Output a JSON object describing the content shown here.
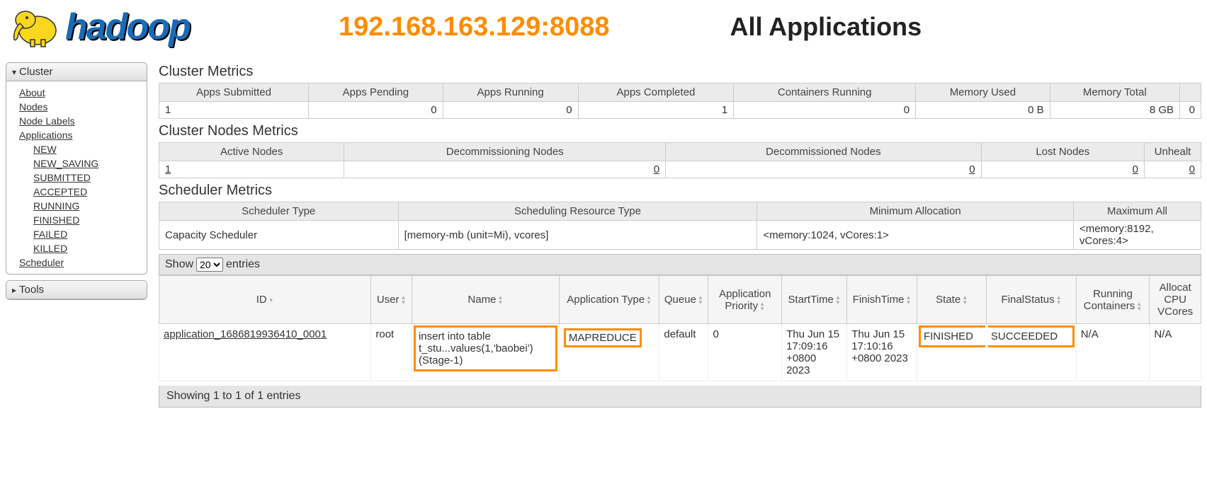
{
  "header": {
    "logo_text": "hadoop",
    "ip": "192.168.163.129:8088",
    "page_title": "All Applications"
  },
  "sidebar": {
    "cluster_label": "Cluster",
    "tools_label": "Tools",
    "links": {
      "about": "About",
      "nodes": "Nodes",
      "node_labels": "Node Labels",
      "applications": "Applications",
      "scheduler": "Scheduler"
    },
    "app_states": {
      "new": "NEW",
      "new_saving": "NEW_SAVING",
      "submitted": "SUBMITTED",
      "accepted": "ACCEPTED",
      "running": "RUNNING",
      "finished": "FINISHED",
      "failed": "FAILED",
      "killed": "KILLED"
    }
  },
  "sections": {
    "cluster_metrics": "Cluster Metrics",
    "cluster_nodes": "Cluster Nodes Metrics",
    "scheduler": "Scheduler Metrics"
  },
  "cluster_metrics": {
    "headers": {
      "apps_submitted": "Apps Submitted",
      "apps_pending": "Apps Pending",
      "apps_running": "Apps Running",
      "apps_completed": "Apps Completed",
      "containers_running": "Containers Running",
      "memory_used": "Memory Used",
      "memory_total": "Memory Total"
    },
    "values": {
      "apps_submitted": "1",
      "apps_pending": "0",
      "apps_running": "0",
      "apps_completed": "1",
      "containers_running": "0",
      "memory_used": "0 B",
      "memory_total": "8 GB",
      "extra": "0"
    }
  },
  "nodes_metrics": {
    "headers": {
      "active": "Active Nodes",
      "decommissioning": "Decommissioning Nodes",
      "decommissioned": "Decommissioned Nodes",
      "lost": "Lost Nodes",
      "unhealthy": "Unhealt"
    },
    "values": {
      "active": "1",
      "decommissioning": "0",
      "decommissioned": "0",
      "lost": "0",
      "unhealthy": "0"
    }
  },
  "scheduler_metrics": {
    "headers": {
      "type": "Scheduler Type",
      "resource_type": "Scheduling Resource Type",
      "min_alloc": "Minimum Allocation",
      "max_alloc": "Maximum All"
    },
    "values": {
      "type": "Capacity Scheduler",
      "resource_type": "[memory-mb (unit=Mi), vcores]",
      "min_alloc": "<memory:1024, vCores:1>",
      "max_alloc": "<memory:8192, vCores:4>"
    }
  },
  "table_controls": {
    "show": "Show",
    "entries": "entries",
    "selected": "20"
  },
  "apps_table": {
    "headers": {
      "id": "ID",
      "user": "User",
      "name": "Name",
      "app_type": "Application Type",
      "queue": "Queue",
      "priority": "Application Priority",
      "start": "StartTime",
      "finish": "FinishTime",
      "state": "State",
      "final_status": "FinalStatus",
      "running_containers": "Running Containers",
      "cpu": "Allocat CPU VCores"
    },
    "row": {
      "id": "application_1686819936410_0001",
      "user": "root",
      "name": "insert into table t_stu...values(1,'baobei')(Stage-1)",
      "app_type": "MAPREDUCE",
      "queue": "default",
      "priority": "0",
      "start": "Thu Jun 15 17:09:16 +0800 2023",
      "finish": "Thu Jun 15 17:10:16 +0800 2023",
      "state": "FINISHED",
      "final_status": "SUCCEEDED",
      "running_containers": "N/A",
      "cpu": "N/A"
    }
  },
  "footer": {
    "showing": "Showing 1 to 1 of 1 entries"
  }
}
